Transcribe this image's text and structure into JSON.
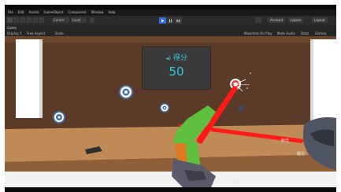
{
  "menu": [
    "File",
    "Edit",
    "Assets",
    "GameObject",
    "Component",
    "Window",
    "Help"
  ],
  "toolbar": {
    "pivot_label": "Center",
    "space_label": "Local",
    "account_label": "Account",
    "layers_label": "Layers",
    "layout_label": "Layout"
  },
  "game_view": {
    "tab_label": "Game",
    "display_label": "Display 1",
    "resolution_label": "Free Aspect",
    "scale_label": "Scale",
    "maximize_label": "Maximize On Play",
    "mute_label": "Mute Audio",
    "stats_label": "Stats",
    "gizmos_label": "Gizmos"
  },
  "hud": {
    "score_label": "得分",
    "score_value": "50"
  },
  "controller": {
    "trigger_label": "扣扳",
    "grip_label": "握住",
    "shoot_label": "射击"
  }
}
